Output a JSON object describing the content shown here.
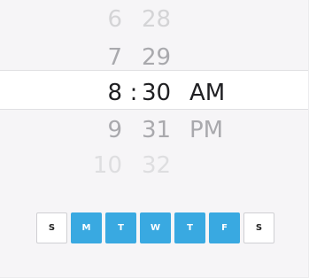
{
  "picker": {
    "rows": [
      {
        "hour": "6",
        "minute": "28",
        "period": ""
      },
      {
        "hour": "7",
        "minute": "29",
        "period": ""
      },
      {
        "hour": "8",
        "separator": ":",
        "minute": "30",
        "period": "AM"
      },
      {
        "hour": "9",
        "minute": "31",
        "period": "PM"
      },
      {
        "hour": "10",
        "minute": "32",
        "period": ""
      }
    ]
  },
  "weekdays": [
    {
      "label": "S",
      "selected": false
    },
    {
      "label": "M",
      "selected": true
    },
    {
      "label": "T",
      "selected": true
    },
    {
      "label": "W",
      "selected": true
    },
    {
      "label": "T",
      "selected": true
    },
    {
      "label": "F",
      "selected": true
    },
    {
      "label": "S",
      "selected": false
    }
  ],
  "colors": {
    "accent": "#39a9e1",
    "background": "#f6f5f7",
    "selected_text": "#1f1f22"
  }
}
